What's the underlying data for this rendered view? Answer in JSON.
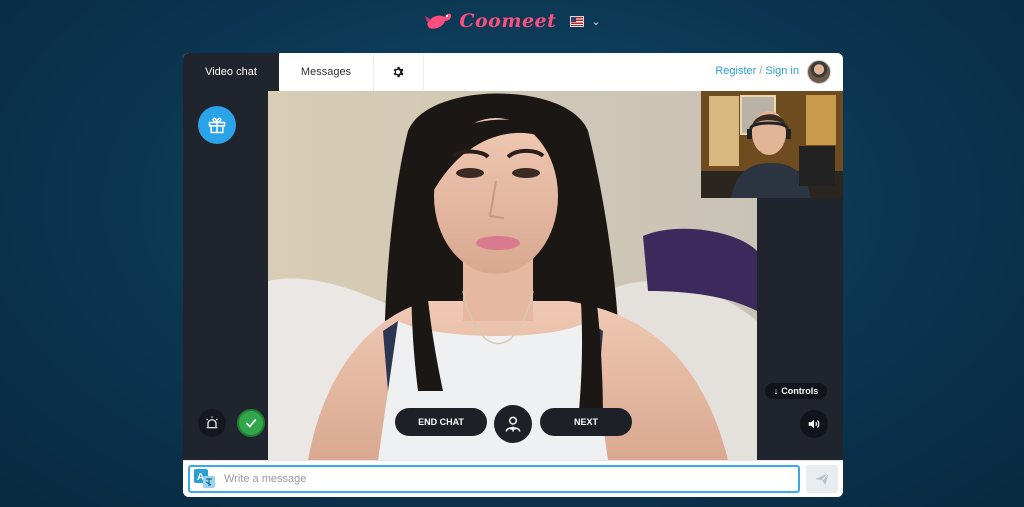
{
  "header": {
    "brand": "Coomeet",
    "brand_icon": "bird-logo-icon",
    "language_flag": "us-flag-icon"
  },
  "topbar": {
    "tab_video": "Video chat",
    "tab_messages": "Messages",
    "settings_icon": "gear-icon",
    "register_label": "Register",
    "separator": "/",
    "signin_label": "Sign in"
  },
  "video": {
    "end_chat_label": "END CHAT",
    "next_label": "NEXT",
    "controls_label": "Controls"
  },
  "message": {
    "placeholder": "Write a message",
    "value": ""
  },
  "colors": {
    "accent": "#2aa3e8",
    "brand": "#ff4e7e",
    "dark_panel": "#20242d",
    "verified": "#31a64a"
  }
}
